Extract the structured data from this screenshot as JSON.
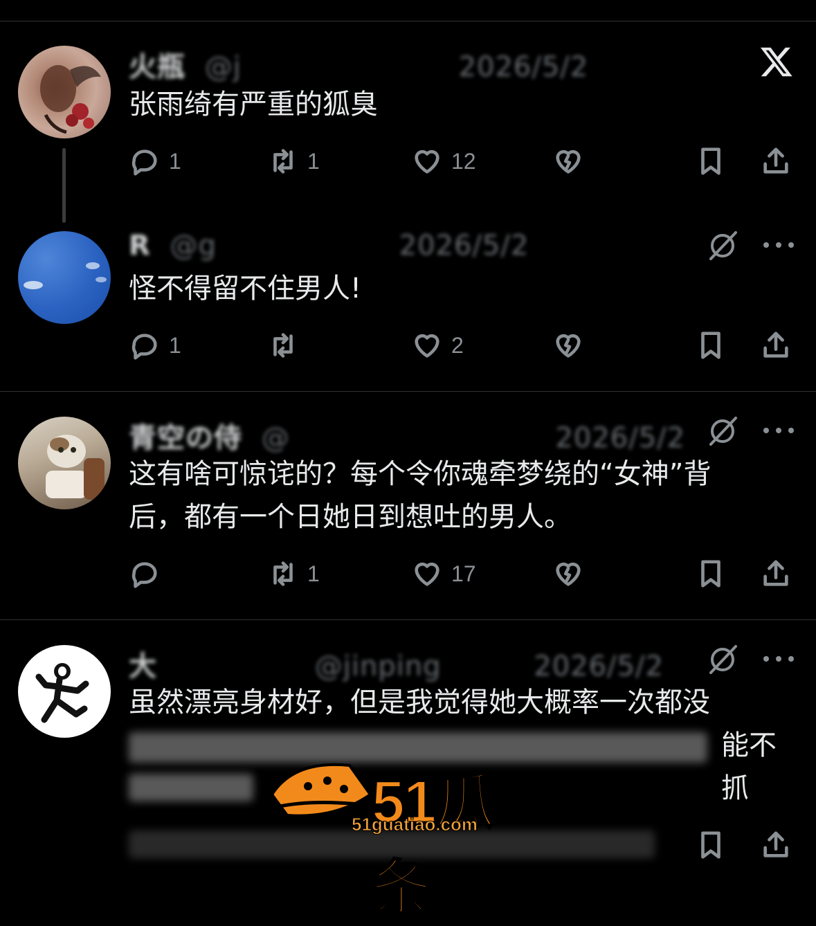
{
  "tweets": [
    {
      "author": "火瓶",
      "handle": "@j",
      "date": "2026/5/2",
      "text": "张雨绮有严重的狐臭",
      "replies": "1",
      "retweets": "1",
      "likes": "12"
    },
    {
      "author": "R",
      "handle": "@g",
      "date": "2026/5/2",
      "text": "怪不得留不住男人!",
      "replies": "1",
      "retweets": "",
      "likes": "2"
    },
    {
      "author": "青空の侍",
      "handle": "@",
      "date": "2026/5/2",
      "text_line1": "这有啥可惊诧的？每个令你魂牵梦绕的“女神”背",
      "text_line2": "后，都有一个日她日到想吐的男人。",
      "replies": "",
      "retweets": "1",
      "likes": "17"
    },
    {
      "author": "大",
      "handle": "@jinping",
      "date": "2026/5/2",
      "text_line1": "虽然漂亮身材好，但是我觉得她大概率一次都没",
      "text_line2_visible": "能不抓"
    }
  ],
  "watermark": {
    "brand": "51瓜条",
    "url": "51guatiao.com"
  },
  "icons": {
    "reply": "reply-icon",
    "retweet": "retweet-icon",
    "like": "heart-icon",
    "dislike": "broken-heart-icon",
    "bookmark": "bookmark-icon",
    "share": "share-icon",
    "translate": "translate-icon",
    "more": "more-icon",
    "brand": "x-logo-icon"
  },
  "colors": {
    "background": "#000000",
    "text": "#e7e9ea",
    "muted": "#71767b",
    "watermark": "#f28a1b"
  }
}
